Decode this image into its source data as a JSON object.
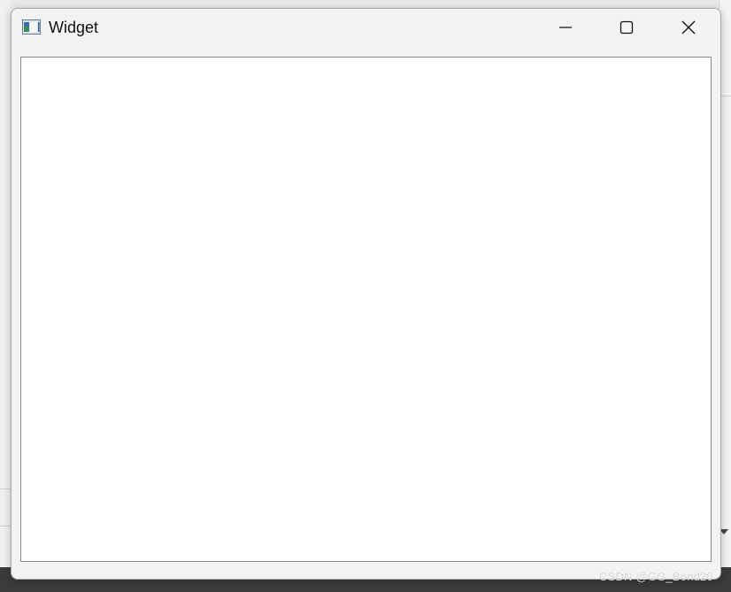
{
  "window": {
    "title": "Widget",
    "icon": "qt-widget-app-icon",
    "buttons": {
      "minimize": "minimize-icon",
      "maximize": "maximize-icon",
      "close": "close-icon"
    }
  },
  "watermark": {
    "text": "CSDN @GG_Bond20"
  },
  "colors": {
    "titlebar": "#f3f3f3",
    "client": "#ffffff",
    "border": "#8a8a8a"
  }
}
